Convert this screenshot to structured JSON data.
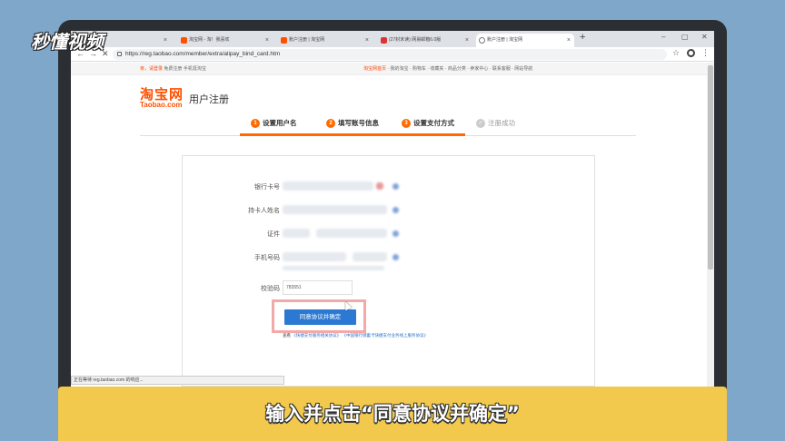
{
  "watermark": "秒懂视频",
  "browser": {
    "tabs": [
      {
        "label": "淘宝网 - 淘！我喜欢"
      },
      {
        "label": "账户注册 | 淘宝网"
      },
      {
        "label": "(27封未读) 网易邮箱6.0版"
      },
      {
        "label": "账户注册 | 淘宝网"
      }
    ],
    "url": "https://reg.taobao.com/member/extra/alipay_bind_card.htm",
    "status": "正在等待 reg.taobao.com 的响应..."
  },
  "sitenav": {
    "greeting": "亲，请登录",
    "signup": "免费注册",
    "mobile": "手机逛淘宝",
    "right_items": [
      "淘宝网首页",
      "我的淘宝",
      "购物车",
      "收藏夹",
      "商品分类",
      "卖家中心",
      "联系客服",
      "网站导航"
    ]
  },
  "header": {
    "logo_cn": "淘宝网",
    "logo_en": "Taobao.com",
    "title": "用户注册"
  },
  "steps": [
    {
      "num": "1",
      "label": "设置用户名"
    },
    {
      "num": "2",
      "label": "填写账号信息"
    },
    {
      "num": "3",
      "label": "设置支付方式"
    },
    {
      "num": "✓",
      "label": "注册成功"
    }
  ],
  "form": {
    "card_label": "银行卡号",
    "holder_label": "持卡人姓名",
    "id_label": "证件",
    "phone_label": "手机号码",
    "code_label": "校验码",
    "code_value": "783551",
    "agree_button": "同意协议并确定",
    "agree_prefix": "查看",
    "agree_link1": "《快捷支付服务相关协议》",
    "agree_link2": "《中国银行储蓄卡快捷支付业务线上服务协议》"
  },
  "caption": "输入并点击“同意协议并确定”"
}
